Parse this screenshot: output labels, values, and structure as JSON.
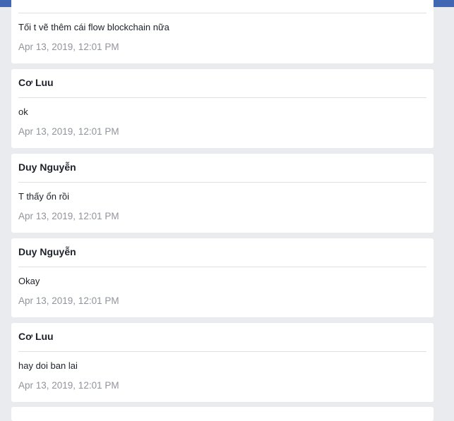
{
  "topbar": {
    "logo_icon": "facebook-logo-icon",
    "avatar_icon": "avatar-icon"
  },
  "messages": [
    {
      "name": "",
      "text": "Tối t vẽ thêm cái flow blockchain nữa",
      "time": "Apr 13, 2019, 12:01 PM"
    },
    {
      "name": "Cơ Luu",
      "text": "ok",
      "time": "Apr 13, 2019, 12:01 PM"
    },
    {
      "name": "Duy Nguyễn",
      "text": "T thấy ổn rồi",
      "time": "Apr 13, 2019, 12:01 PM"
    },
    {
      "name": "Duy Nguyễn",
      "text": "Okay",
      "time": "Apr 13, 2019, 12:01 PM"
    },
    {
      "name": "Cơ Luu",
      "text": "hay doi ban lai",
      "time": "Apr 13, 2019, 12:01 PM"
    }
  ]
}
